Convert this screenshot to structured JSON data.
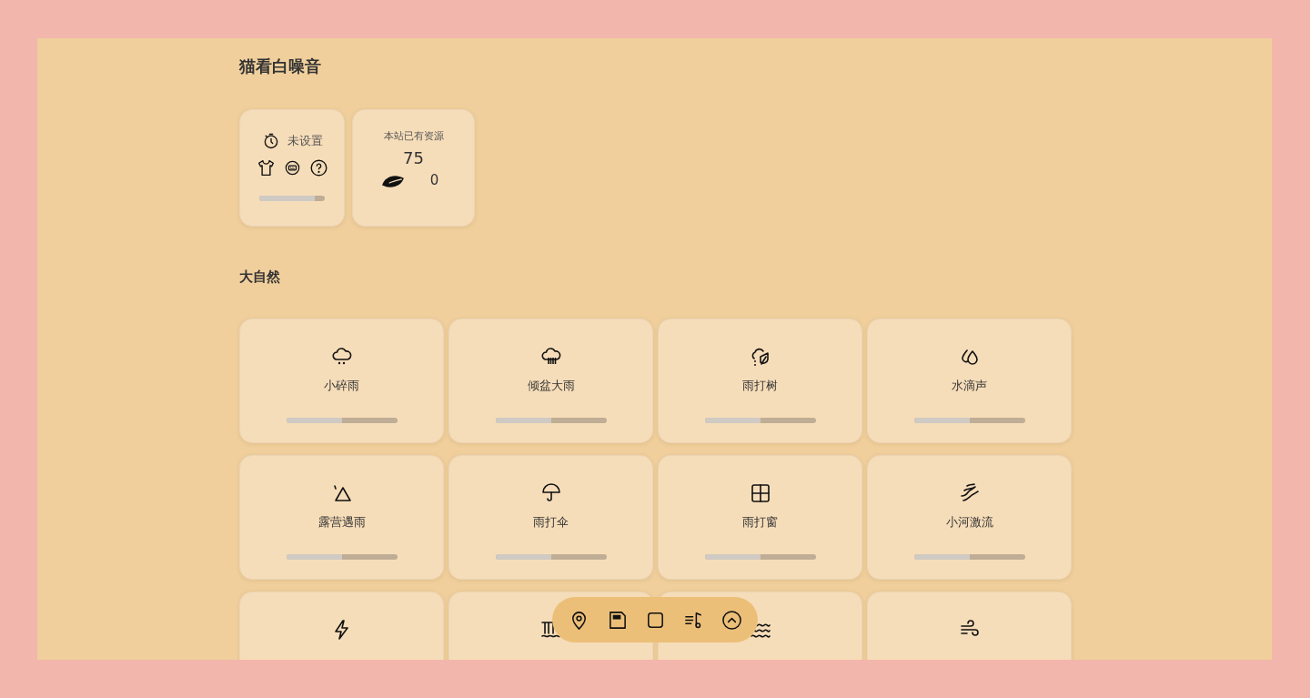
{
  "app_title": "猫看白噪音",
  "timer": {
    "label": "未设置",
    "level": 0.85
  },
  "resources": {
    "title": "本站已有资源",
    "total": "75",
    "favorites": "0"
  },
  "sections": [
    {
      "title": "大自然",
      "sounds": [
        {
          "kind": "drizzle",
          "name": "小碎雨",
          "level": 0.5
        },
        {
          "kind": "downpour",
          "name": "倾盆大雨",
          "level": 0.5
        },
        {
          "kind": "rain-tree",
          "name": "雨打树",
          "level": 0.5
        },
        {
          "kind": "drops",
          "name": "水滴声",
          "level": 0.5
        },
        {
          "kind": "tent",
          "name": "露营遇雨",
          "level": 0.5
        },
        {
          "kind": "umbrella",
          "name": "雨打伞",
          "level": 0.5
        },
        {
          "kind": "window",
          "name": "雨打窗",
          "level": 0.5
        },
        {
          "kind": "stream",
          "name": "小河激流",
          "level": 0.5
        },
        {
          "kind": "lightning"
        },
        {
          "kind": "waterfall"
        },
        {
          "kind": "waves"
        },
        {
          "kind": "wind"
        }
      ]
    }
  ],
  "dock": [
    {
      "kind": "pin"
    },
    {
      "kind": "save"
    },
    {
      "kind": "stop"
    },
    {
      "kind": "playlist"
    },
    {
      "kind": "up"
    }
  ]
}
